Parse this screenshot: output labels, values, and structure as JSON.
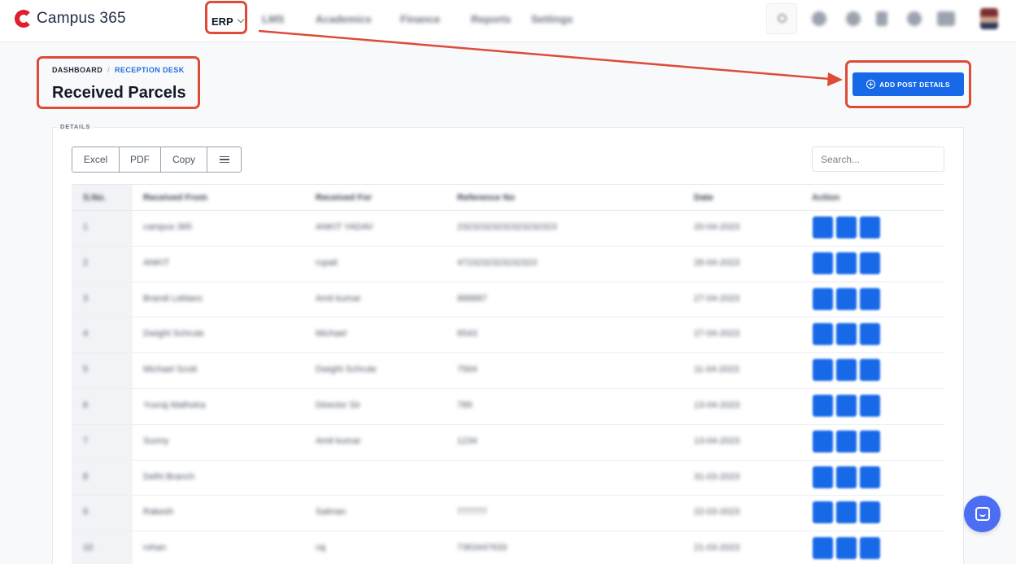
{
  "app": {
    "brand": "Campus 365"
  },
  "nav": {
    "erp_label": "ERP",
    "items": [
      "LMS",
      "Academics",
      "Finance",
      "Reports",
      "Settings"
    ]
  },
  "breadcrumb": {
    "root": "DASHBOARD",
    "separator": "/",
    "current": "RECEPTION DESK"
  },
  "page": {
    "title": "Received Parcels",
    "add_button_label": "ADD POST DETAILS"
  },
  "section": {
    "legend": "DETAILS"
  },
  "toolbar": {
    "excel": "Excel",
    "pdf": "PDF",
    "copy": "Copy"
  },
  "search": {
    "placeholder": "Search..."
  },
  "table": {
    "headers": [
      "S.No.",
      "Received From",
      "Received For",
      "Reference No",
      "Date",
      "Action"
    ],
    "rows": [
      [
        "1",
        "campus 365",
        "ANKIT YADAV",
        "23232323232323232323",
        "20-04-2023"
      ],
      [
        "2",
        "ANKIT",
        "rupali",
        "4723232323232323",
        "26-04-2023"
      ],
      [
        "3",
        "Brandi Leblanc",
        "Amit kumar",
        "888887",
        "27-04-2023"
      ],
      [
        "4",
        "Dwight Schrute",
        "Michael",
        "6543",
        "27-04-2023"
      ],
      [
        "5",
        "Michael Scott",
        "Dwight Schrute",
        "7564",
        "11-04-2023"
      ],
      [
        "6",
        "Yuvraj Malhotra",
        "Director Sir",
        "789",
        "13-04-2023"
      ],
      [
        "7",
        "Sunny",
        "Amit kumar",
        "1234",
        "13-04-2023"
      ],
      [
        "8",
        "Delhi Branch",
        "",
        "",
        "31-03-2023"
      ],
      [
        "9",
        "Rakesh",
        "Salman",
        "777777",
        "22-03-2023"
      ],
      [
        "10",
        "rohan",
        "raj",
        "7363447633",
        "21-03-2023"
      ]
    ]
  },
  "colors": {
    "accent": "#1769e8",
    "annotation": "#dd4b39",
    "brand_red": "#e11d2e",
    "chat": "#4b6ef5"
  }
}
